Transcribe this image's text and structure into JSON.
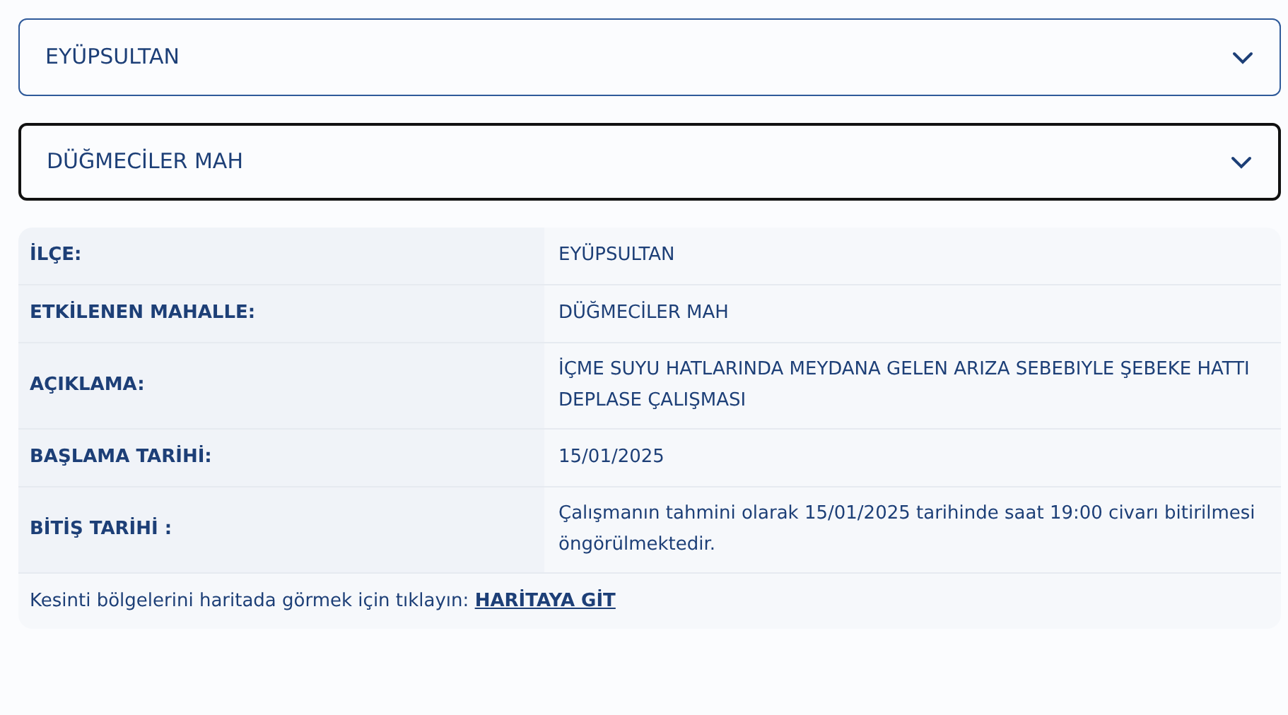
{
  "selects": [
    {
      "value": "EYÜPSULTAN",
      "focused": false
    },
    {
      "value": "DÜĞMECİLER MAH",
      "focused": true
    }
  ],
  "details": [
    {
      "label": "İLÇE:",
      "value": "EYÜPSULTAN"
    },
    {
      "label": "ETKİLENEN MAHALLE:",
      "value": "DÜĞMECİLER MAH"
    },
    {
      "label": "AÇIKLAMA:",
      "value": "İÇME SUYU HATLARINDA MEYDANA GELEN ARIZA SEBEBIYLE ŞEBEKE HATTI DEPLASE ÇALIŞMASI"
    },
    {
      "label": "BAŞLAMA TARİHİ:",
      "value": "15/01/2025"
    },
    {
      "label": "BİTİŞ TARİHİ :",
      "value": "Çalışmanın tahmini olarak 15/01/2025 tarihinde saat 19:00 civarı bitirilmesi öngörülmektedir."
    }
  ],
  "map_note": {
    "text": "Kesinti bölgelerini haritada görmek için tıklayın:",
    "link": "HARİTAYA GİT"
  }
}
